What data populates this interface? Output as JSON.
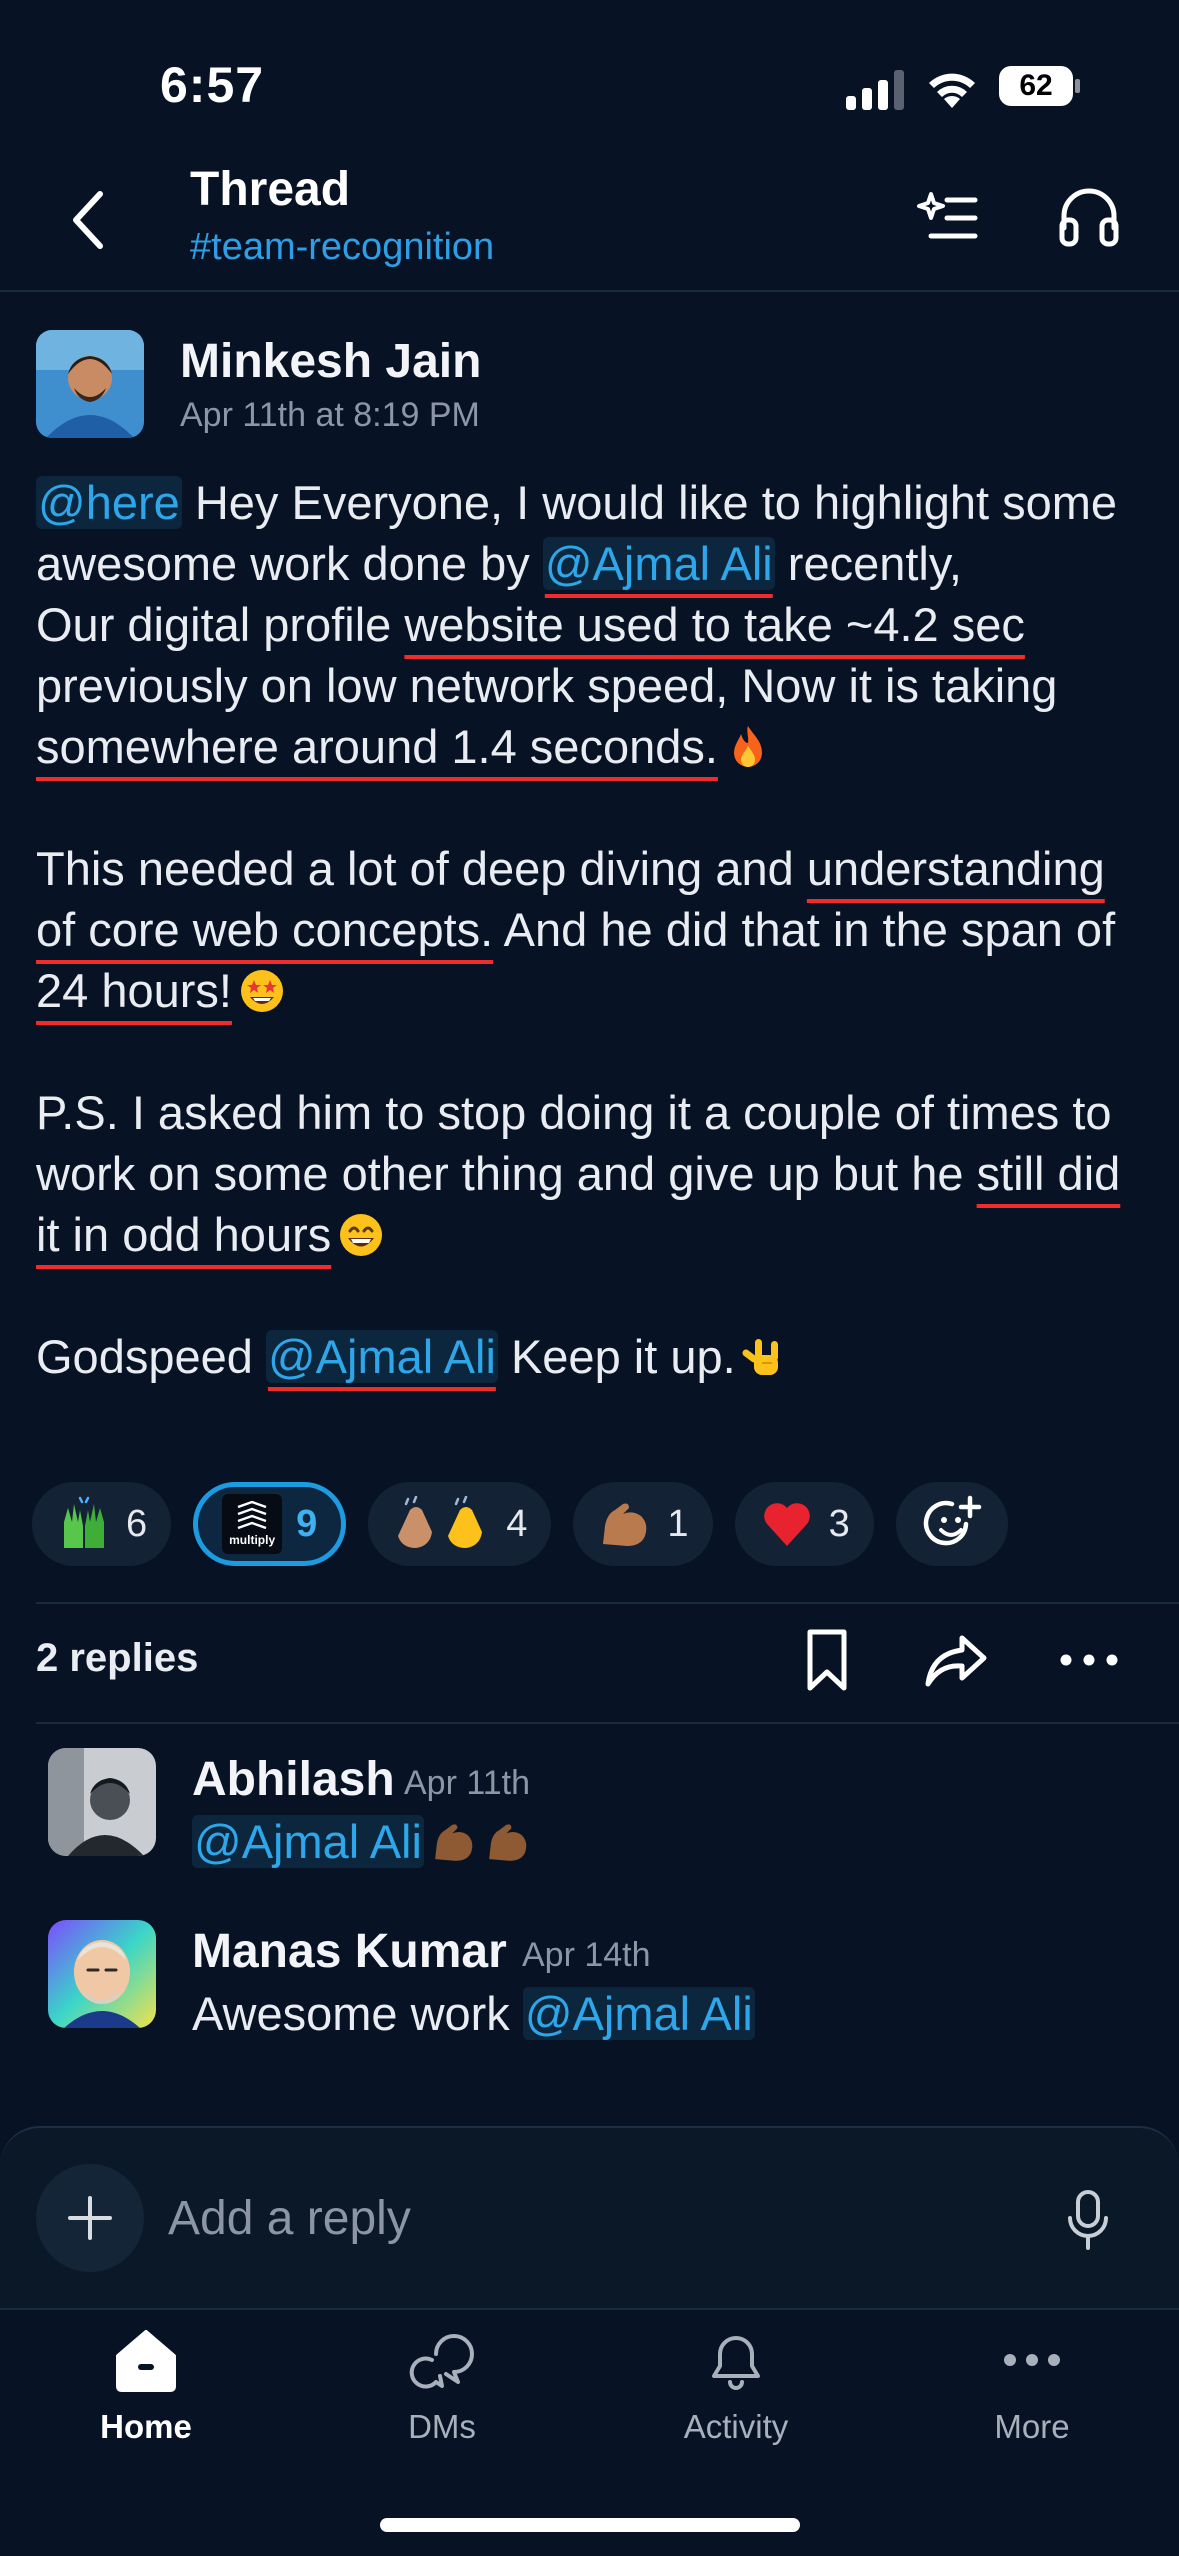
{
  "status_bar": {
    "time": "6:57",
    "battery": "62"
  },
  "header": {
    "title": "Thread",
    "channel": "#team-recognition"
  },
  "message": {
    "author": "Minkesh Jain",
    "timestamp": "Apr 11th at 8:19 PM",
    "p1": {
      "mention_here": "@here",
      "t1": " Hey Everyone, I would like to highlight some awesome work done by ",
      "mention_user": "@Ajmal Ali",
      "t2": " recently,",
      "t3": "Our digital profile ",
      "u1": "website used to take ~4.2 sec",
      "t4": " previously on low network speed, Now it is taking ",
      "u2": "somewhere around 1.4 seconds."
    },
    "p2": {
      "t1": "This needed a lot of deep diving and ",
      "u1": "understanding of core web concepts.",
      "t2": " And he did that in the span of ",
      "u2": "24 hours!"
    },
    "p3": {
      "t1": "P.S. I asked him to stop doing it a couple of times to work on some other thing and give up but he ",
      "u1": "still did it in odd hours"
    },
    "p4": {
      "t1": "Godspeed ",
      "mention_user": "@Ajmal Ali",
      "t2": " Keep it up."
    }
  },
  "reactions": [
    {
      "icon": "raised-hands-emoji",
      "count": "6"
    },
    {
      "icon": "multiply-custom-emoji",
      "logo_text": "multiply",
      "count": "9",
      "active": true
    },
    {
      "icon": "clapping-hands-emoji",
      "count": "4"
    },
    {
      "icon": "flexed-biceps-emoji",
      "count": "1"
    },
    {
      "icon": "red-heart-emoji",
      "count": "3"
    }
  ],
  "thread_bar": {
    "replies_label": "2 replies"
  },
  "replies": [
    {
      "author": "Abhilash",
      "timestamp": "Apr 11th",
      "mention": "@Ajmal Ali"
    },
    {
      "author": "Manas Kumar",
      "timestamp": "Apr 14th",
      "text": "Awesome work ",
      "mention": "@Ajmal Ali"
    }
  ],
  "composer": {
    "placeholder": "Add a reply"
  },
  "tabs": [
    {
      "label": "Home",
      "icon": "home-icon",
      "active": true
    },
    {
      "label": "DMs",
      "icon": "dms-icon"
    },
    {
      "label": "Activity",
      "icon": "bell-icon"
    },
    {
      "label": "More",
      "icon": "more-icon"
    }
  ],
  "colors": {
    "background": "#071325",
    "mention": "#2ea7ea",
    "underline_annotation": "#ef2b2b",
    "active_reaction": "#1d9be0"
  }
}
